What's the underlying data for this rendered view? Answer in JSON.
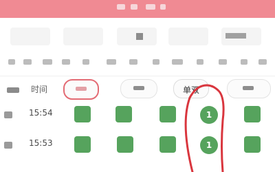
{
  "header": {
    "accent": "#f08a93"
  },
  "filter": {
    "time_label": "时间",
    "selected_chip": "单双"
  },
  "rows": [
    {
      "time": "15:54",
      "value": "1"
    },
    {
      "time": "15:53",
      "value": "1"
    }
  ],
  "colors": {
    "result_green": "#56a35d",
    "annotation_red": "#d9363e"
  }
}
